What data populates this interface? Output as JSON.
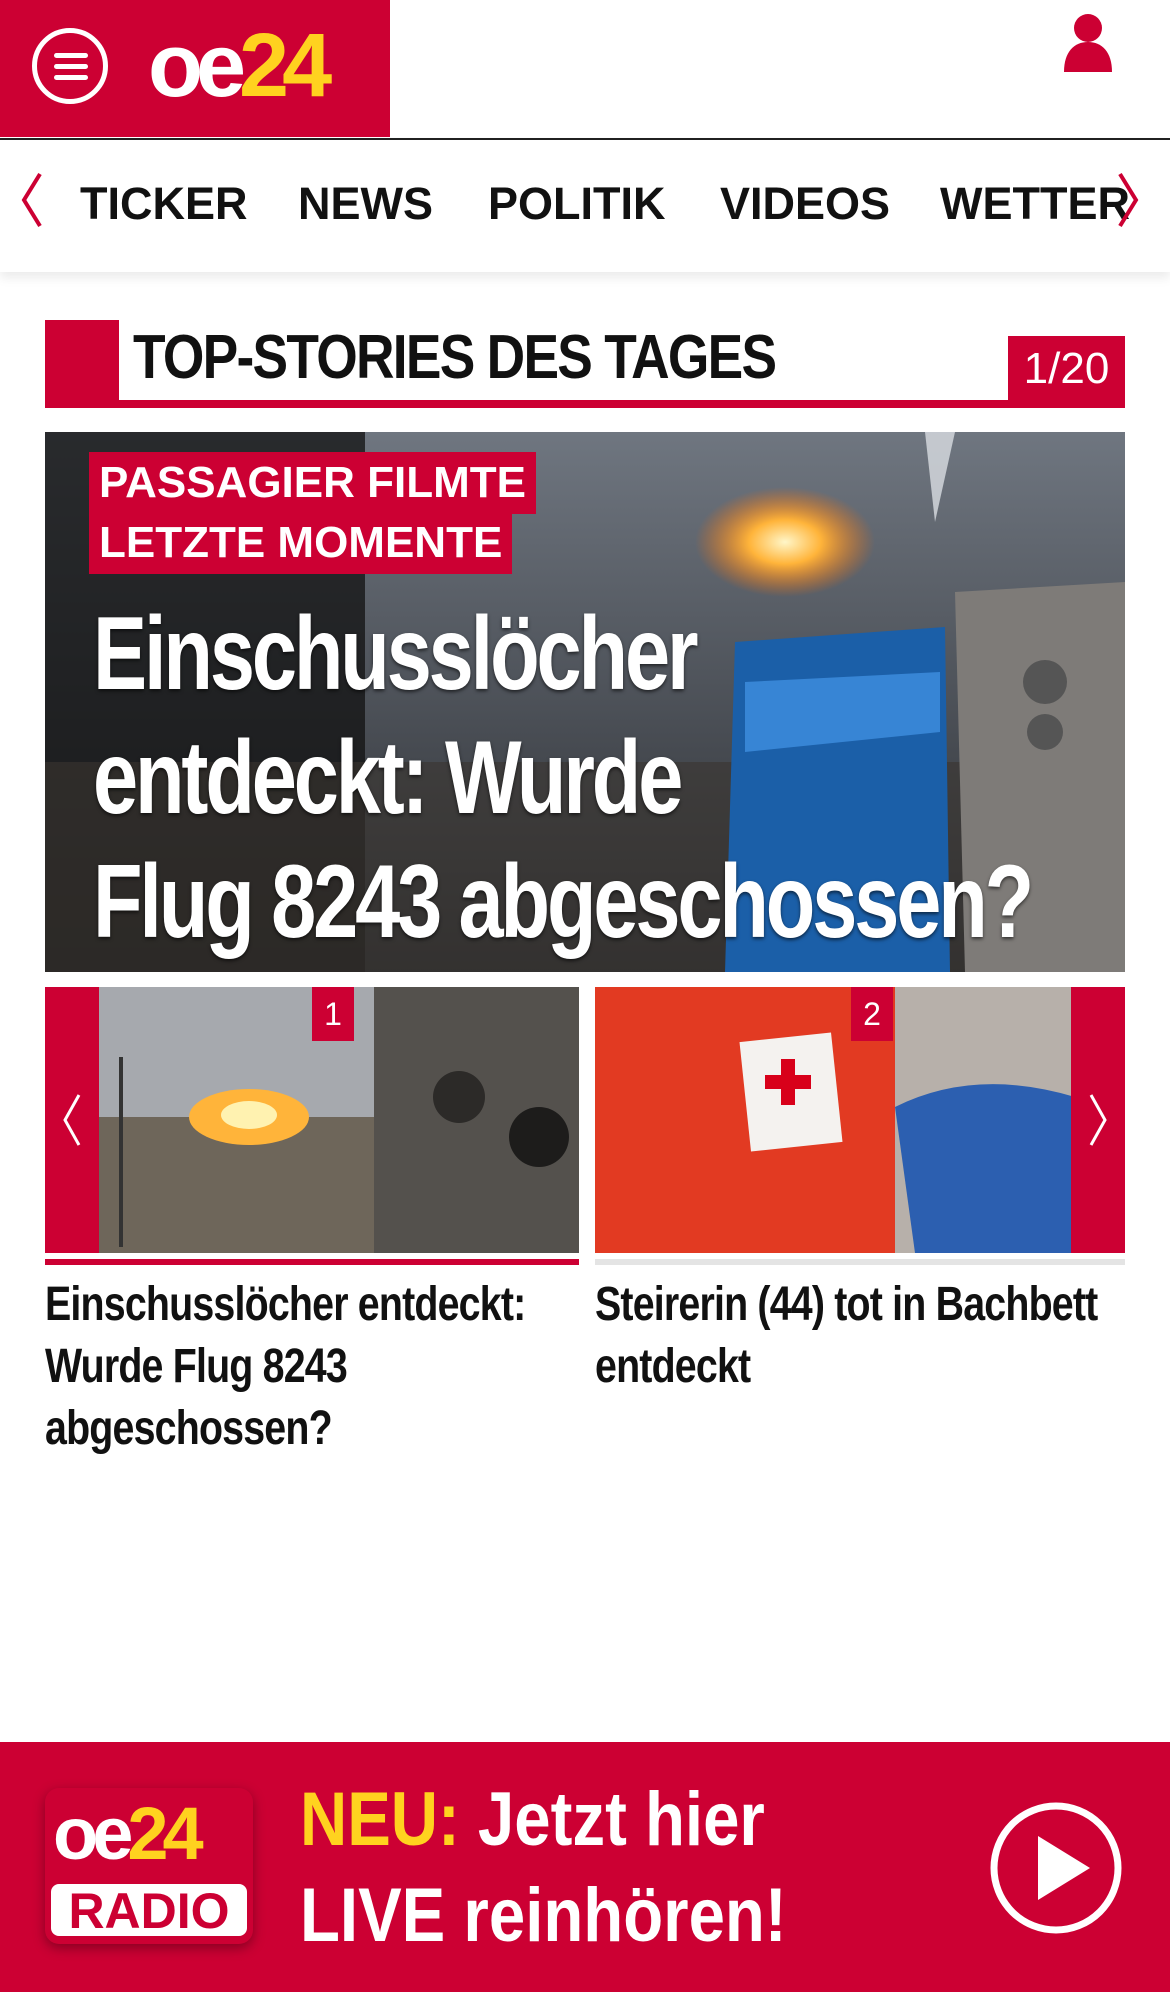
{
  "header": {
    "logo_oe": "oe",
    "logo_num": "24"
  },
  "nav": {
    "items": [
      "TICKER",
      "NEWS",
      "POLITIK",
      "VIDEOS",
      "WETTER"
    ]
  },
  "section": {
    "title": "TOP-STORIES DES TAGES",
    "counter": "1/20"
  },
  "hero": {
    "kicker_line1": "PASSAGIER FILMTE",
    "kicker_line2": "LETZTE MOMENTE",
    "headline_line1": "Einschusslöcher",
    "headline_line2": "entdeckt: Wurde",
    "headline_line3": "Flug 8243 abgeschossen?"
  },
  "cards": [
    {
      "number": "1",
      "title": "Einschusslöcher entdeckt: Wurde Flug 8243 abgeschossen?"
    },
    {
      "number": "2",
      "title": "Steirerin (44) tot in Bachbett entdeckt"
    }
  ],
  "radio": {
    "logo_oe": "oe",
    "logo_num": "24",
    "logo_label": "RADIO",
    "highlight": "NEU:",
    "line1_rest": " Jetzt hier",
    "line2": "LIVE reinhören!"
  },
  "colors": {
    "brand_red": "#cc0033",
    "brand_yellow": "#ffd21f"
  },
  "icons": [
    "menu-icon",
    "user-icon",
    "chevron-left-icon",
    "chevron-right-icon",
    "play-icon"
  ]
}
